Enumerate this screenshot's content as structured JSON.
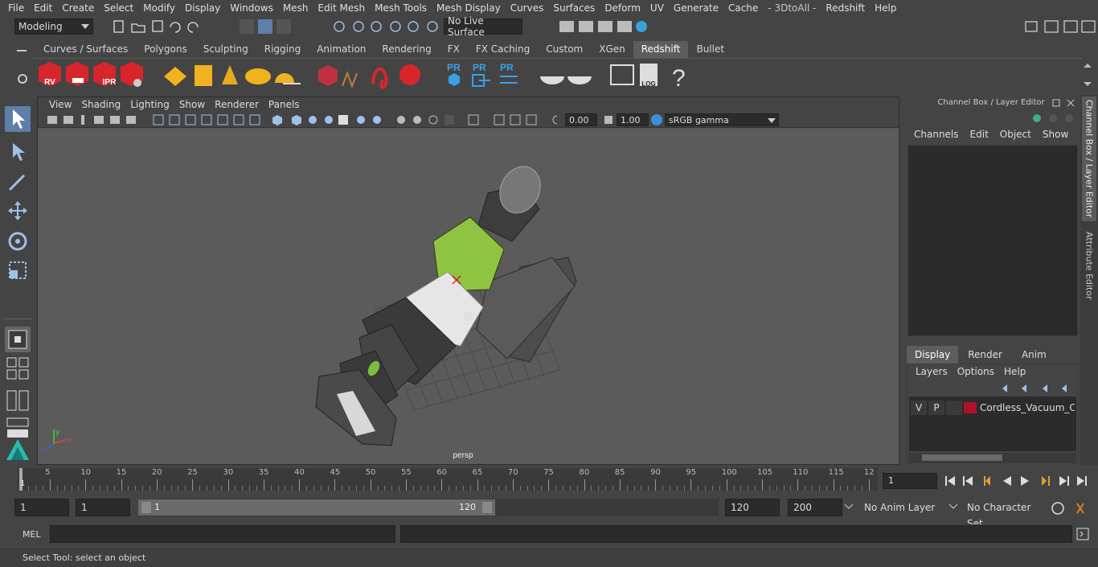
{
  "menubar": {
    "items": [
      "File",
      "Edit",
      "Create",
      "Select",
      "Modify",
      "Display",
      "Windows",
      "Mesh",
      "Edit Mesh",
      "Mesh Tools",
      "Mesh Display",
      "Curves",
      "Surfaces",
      "Deform",
      "UV",
      "Generate",
      "Cache",
      "- 3DtoAll -",
      "Redshift",
      "Help"
    ]
  },
  "statusline": {
    "mode": "Modeling",
    "live_surface": "No Live Surface"
  },
  "shelf": {
    "tabs": [
      "Curves / Surfaces",
      "Polygons",
      "Sculpting",
      "Rigging",
      "Animation",
      "Rendering",
      "FX",
      "FX Caching",
      "Custom",
      "XGen",
      "Redshift",
      "Bullet"
    ],
    "active_tab": "Redshift",
    "rv_label": "RV",
    "ipr_label": "IPR",
    "pr_label": "PR",
    "log_label": "LOG",
    "help_label": "?"
  },
  "viewport": {
    "menu": [
      "View",
      "Shading",
      "Lighting",
      "Show",
      "Renderer",
      "Panels"
    ],
    "exposure": "0.00",
    "gamma": "1.00",
    "color_space": "sRGB gamma",
    "camera_label": "persp",
    "axis_x": "x",
    "axis_y": "y",
    "axis_z": "z"
  },
  "channelbox": {
    "title": "Channel Box / Layer Editor",
    "menu": [
      "Channels",
      "Edit",
      "Object",
      "Show"
    ],
    "layer_tabs": [
      "Display",
      "Render",
      "Anim"
    ],
    "active_layer_tab": "Display",
    "layer_menu": [
      "Layers",
      "Options",
      "Help"
    ],
    "layer": {
      "v": "V",
      "p": "P",
      "name": "Cordless_Vacuum_Clea",
      "color": "#b0102a"
    }
  },
  "sidetabs": {
    "channel": "Channel Box / Layer Editor",
    "attribute": "Attribute Editor"
  },
  "timeslider": {
    "ticks": [
      "5",
      "10",
      "15",
      "20",
      "25",
      "30",
      "35",
      "40",
      "45",
      "50",
      "55",
      "60",
      "65",
      "70",
      "75",
      "80",
      "85",
      "90",
      "95",
      "100",
      "105",
      "110",
      "115",
      "12"
    ],
    "start_label": "1",
    "current_frame": "1"
  },
  "range": {
    "start": "1",
    "playback_start": "1",
    "slider_start": "1",
    "slider_end": "120",
    "playback_end": "120",
    "end": "200",
    "anim_layer": "No Anim Layer",
    "character_set": "No Character Set"
  },
  "cmdline": {
    "lang": "MEL"
  },
  "helpline": {
    "text": "Select Tool: select an object"
  }
}
